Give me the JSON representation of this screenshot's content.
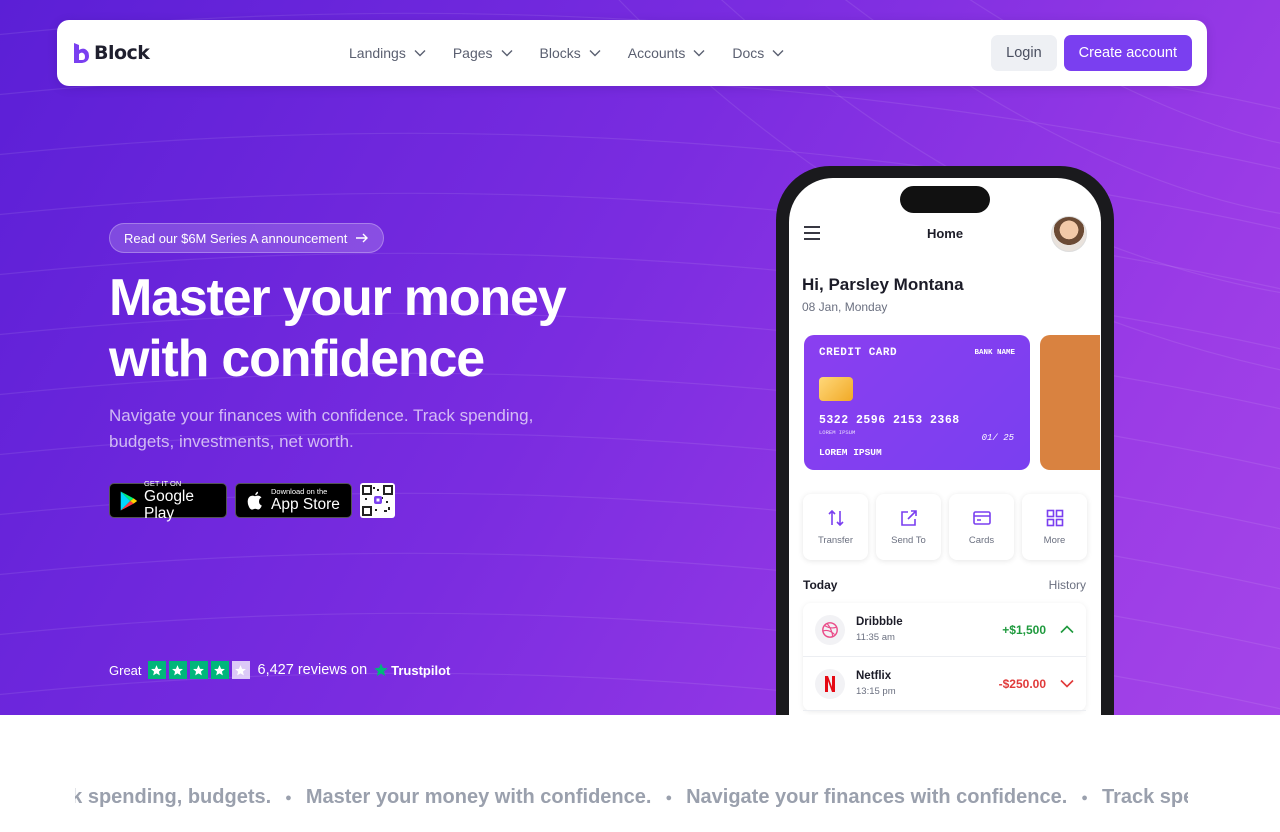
{
  "brand": {
    "name": "Block",
    "accent": "#7a3ff0"
  },
  "nav": {
    "items": [
      {
        "label": "Landings"
      },
      {
        "label": "Pages"
      },
      {
        "label": "Blocks"
      },
      {
        "label": "Accounts"
      },
      {
        "label": "Docs"
      }
    ],
    "login_label": "Login",
    "create_label": "Create account"
  },
  "hero": {
    "announcement": "Read our $6M Series A announcement",
    "headline_line1": "Master your money",
    "headline_line2": "with confidence",
    "subtext": "Navigate your finances with confidence. Track spending, budgets, investments, net worth.",
    "google_play": {
      "small": "GET IT ON",
      "big": "Google Play"
    },
    "app_store": {
      "small": "Download on the",
      "big": "App Store"
    }
  },
  "rating": {
    "label": "Great",
    "stars_filled": 4,
    "stars_total": 5,
    "reviews": "6,427 reviews on",
    "provider": "Trustpilot"
  },
  "phone": {
    "title": "Home",
    "greeting": "Hi, Parsley Montana",
    "date": "08 Jan, Monday",
    "card": {
      "type": "CREDIT CARD",
      "bank": "BANK NAME",
      "number": "5322 2596 2153 2368",
      "number_label": "LOREM IPSUM",
      "expiry": "01/ 25",
      "holder": "LOREM IPSUM"
    },
    "actions": [
      {
        "label": "Transfer",
        "icon": "transfer-icon"
      },
      {
        "label": "Send To",
        "icon": "send-icon"
      },
      {
        "label": "Cards",
        "icon": "card-icon"
      },
      {
        "label": "More",
        "icon": "grid-icon"
      }
    ],
    "today_label": "Today",
    "history_label": "History",
    "transactions": [
      {
        "name": "Dribbble",
        "time": "11:35 am",
        "amount": "+$1,500"
      },
      {
        "name": "Netflix",
        "time": "13:15 pm",
        "amount": "-$250.00"
      }
    ]
  },
  "marquee": {
    "items": [
      "Track spending, budgets.",
      "Master your money with confidence.",
      "Navigate your finances with confidence.",
      "Track spend"
    ]
  }
}
